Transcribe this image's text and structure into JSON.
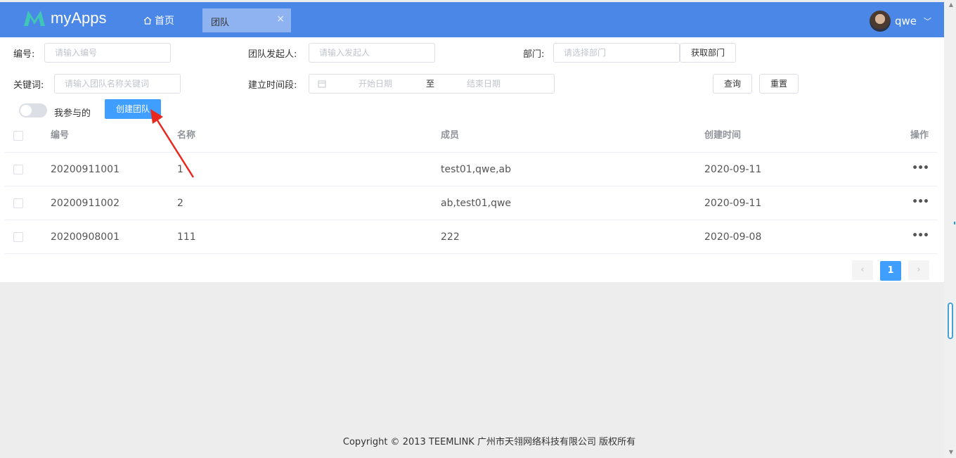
{
  "header": {
    "logo_text": "myApps",
    "home_label": "首页",
    "tab_label": "团队",
    "tab_close": "×",
    "user_name": "qwe",
    "user_chevron": "﹀"
  },
  "filters": {
    "code_label": "编号:",
    "code_placeholder": "请输入编号",
    "initiator_label": "团队发起人:",
    "initiator_placeholder": "请输入发起人",
    "dept_label": "部门:",
    "dept_placeholder": "请选择部门",
    "get_dept_button": "获取部门",
    "keyword_label": "关键词:",
    "keyword_placeholder": "请输入团队名称关键词",
    "period_label": "建立时间段:",
    "start_placeholder": "开始日期",
    "to_label": "至",
    "end_placeholder": "结束日期",
    "query_button": "查询",
    "reset_button": "重置",
    "mine_toggle_label": "我参与的",
    "create_button": "创建团队"
  },
  "table": {
    "columns": [
      "编号",
      "名称",
      "成员",
      "创建时间",
      "操作"
    ],
    "rows": [
      {
        "code": "20200911001",
        "name": "1",
        "members": "test01,qwe,ab",
        "created": "2020-09-11",
        "action": "•••"
      },
      {
        "code": "20200911002",
        "name": "2",
        "members": "ab,test01,qwe",
        "created": "2020-09-11",
        "action": "•••"
      },
      {
        "code": "20200908001",
        "name": "111",
        "members": "222",
        "created": "2020-09-08",
        "action": "•••"
      }
    ]
  },
  "pagination": {
    "prev": "‹",
    "current": "1",
    "next": "›"
  },
  "footer": {
    "copyright": "Copyright © 2013 TEEMLINK 广州市天翎网络科技有限公司 版权所有"
  },
  "colors": {
    "header_bg": "#4a87e6",
    "primary": "#409eff",
    "annotation_arrow": "#e8281e"
  }
}
